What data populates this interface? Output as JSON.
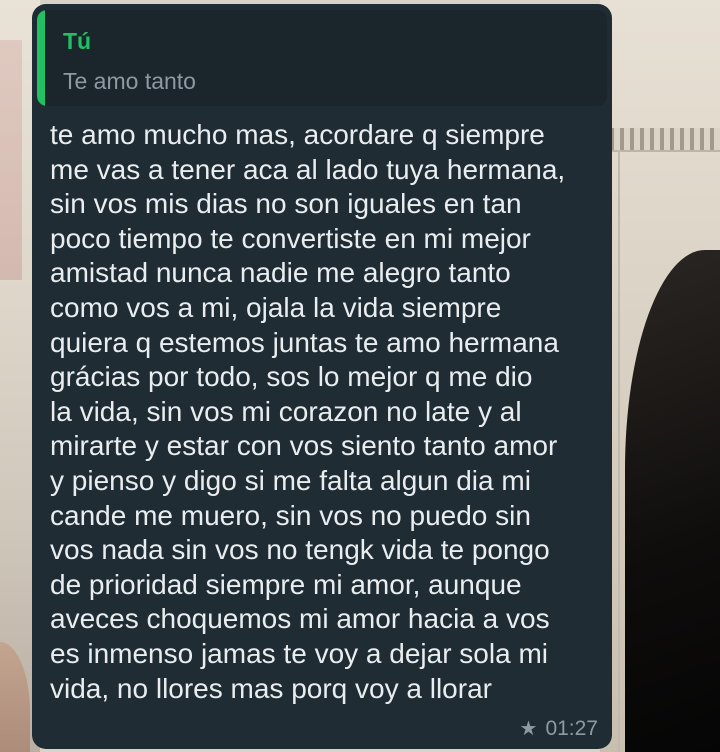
{
  "message": {
    "quoted": {
      "author": "Tú",
      "text": "Te amo tanto"
    },
    "body": "te amo mucho mas, acordare q siempre\nme vas a tener aca al lado tuya hermana,\nsin vos mis dias no son iguales en tan\npoco tiempo te convertiste en mi mejor\namistad nunca nadie me alegro tanto\ncomo vos a mi, ojala la vida siempre\nquiera q estemos juntas te amo hermana\ngrácias por todo, sos lo mejor q me dio\nla vida, sin vos mi corazon no late y al\nmirarte y estar con vos siento tanto amor\ny pienso y digo si me falta algun dia mi\ncande me muero, sin vos no puedo sin\nvos nada sin vos no tengk vida te pongo\nde prioridad siempre mi amor, aunque\naveces choquemos mi amor hacia a vos\nes inmenso jamas te voy a dejar sola mi\nvida, no llores mas porq voy a llorar",
    "time": "01:27",
    "starred_icon": "star-icon"
  },
  "colors": {
    "bubble": "#1f2c34",
    "quote_background": "#1a252c",
    "accent": "#21c063",
    "text": "#e9edef",
    "secondary_text": "#8d9aa2"
  }
}
